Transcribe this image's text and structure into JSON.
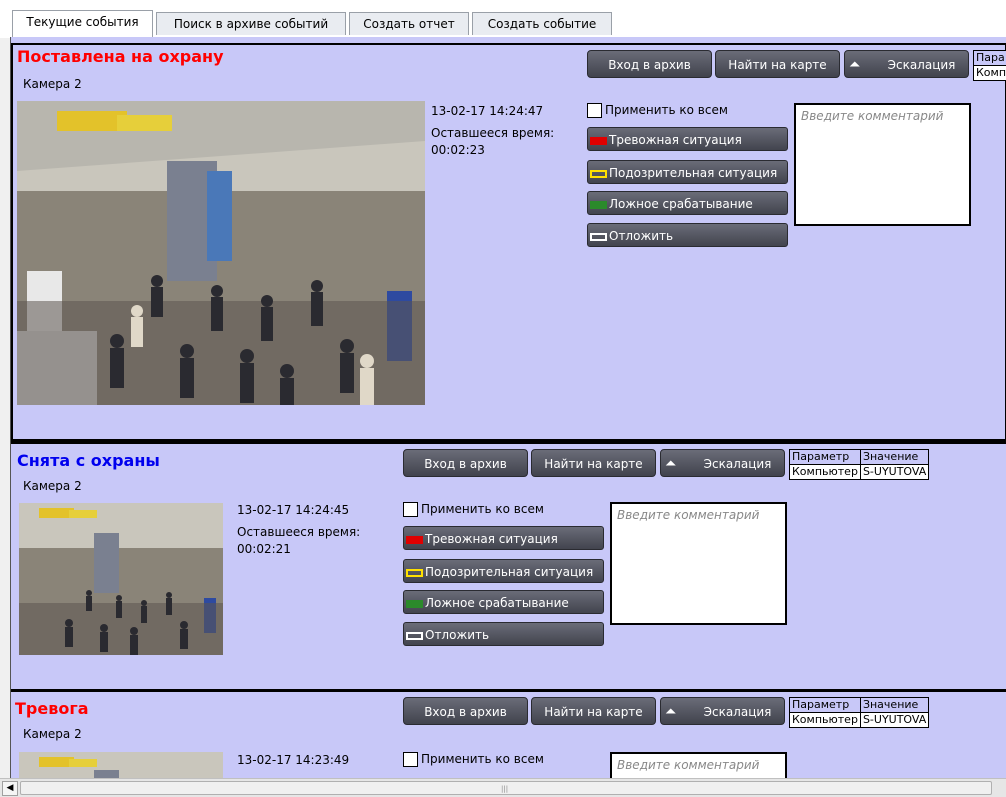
{
  "tabs": [
    {
      "label": "Текущие события",
      "active": true
    },
    {
      "label": "Поиск в архиве событий",
      "active": false
    },
    {
      "label": "Создать отчет",
      "active": false
    },
    {
      "label": "Создать событие",
      "active": false
    }
  ],
  "events": [
    {
      "title": "Поставлена на охрану",
      "title_color": "#ff0000",
      "camera": "Камера 2",
      "timestamp": "13-02-17 14:24:47",
      "remaining_label": "Оставшееся время:",
      "remaining_value": "00:02:23",
      "buttons": {
        "archive": "Вход в архив",
        "map": "Найти на карте",
        "escalation": "Эскалация"
      },
      "apply_all": "Применить ко всем",
      "actions": [
        "Тревожная ситуация",
        "Подозрительная ситуация",
        "Ложное срабатывание",
        "Отложить"
      ],
      "comment_placeholder": "Введите комментарий",
      "params": {
        "header": [
          "Пара",
          ""
        ],
        "row": [
          "Комп",
          ""
        ]
      }
    },
    {
      "title": "Снята с охраны",
      "title_color": "#0000ee",
      "camera": "Камера 2",
      "timestamp": "13-02-17 14:24:45",
      "remaining_label": "Оставшееся время:",
      "remaining_value": "00:02:21",
      "buttons": {
        "archive": "Вход в архив",
        "map": "Найти на карте",
        "escalation": "Эскалация"
      },
      "apply_all": "Применить ко всем",
      "actions": [
        "Тревожная ситуация",
        "Подозрительная ситуация",
        "Ложное срабатывание",
        "Отложить"
      ],
      "comment_placeholder": "Введите комментарий",
      "params": {
        "header": [
          "Параметр",
          "Значение"
        ],
        "row": [
          "Компьютер",
          "S-UYUTOVA"
        ]
      }
    },
    {
      "title": "Тревога",
      "title_color": "#ff0000",
      "camera": "Камера 2",
      "timestamp": "13-02-17 14:23:49",
      "buttons": {
        "archive": "Вход в архив",
        "map": "Найти на карте",
        "escalation": "Эскалация"
      },
      "apply_all": "Применить ко всем",
      "comment_placeholder": "Введите комментарий",
      "params": {
        "header": [
          "Параметр",
          "Значение"
        ],
        "row": [
          "Компьютер",
          "S-UYUTOVA"
        ]
      }
    }
  ],
  "colors": {
    "panel_bg": "#c8c8f8",
    "alarm": "#ff0000",
    "info": "#0000ee"
  },
  "icons": {
    "escalation": "chevron-up-icon",
    "scroll_left": "arrow-left-icon"
  }
}
